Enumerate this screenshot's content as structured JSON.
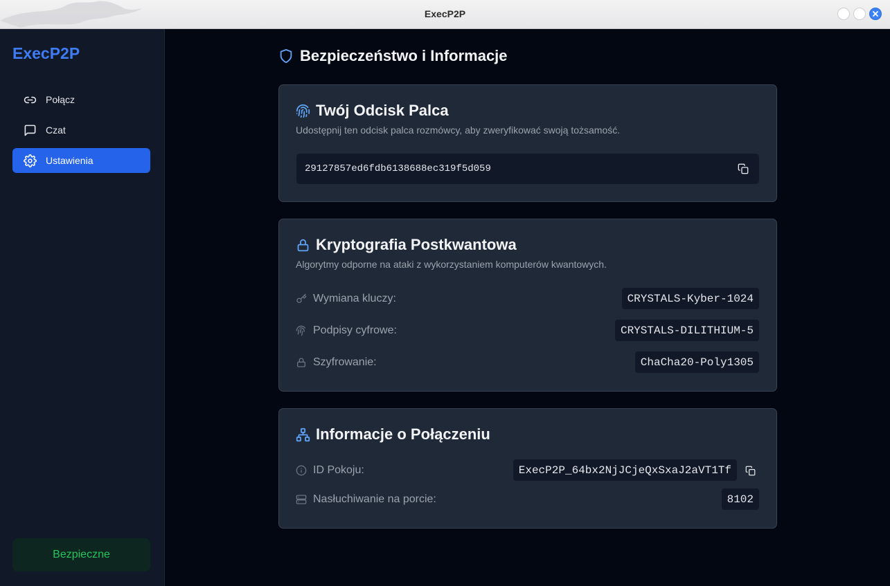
{
  "window": {
    "title": "ExecP2P"
  },
  "sidebar": {
    "brand": "ExecP2P",
    "items": [
      {
        "label": "Połącz",
        "icon": "link-icon",
        "active": false
      },
      {
        "label": "Czat",
        "icon": "chat-icon",
        "active": false
      },
      {
        "label": "Ustawienia",
        "icon": "gear-icon",
        "active": true
      }
    ],
    "status": "Bezpieczne"
  },
  "main": {
    "title": "Bezpieczeństwo i Informacje",
    "fingerprint": {
      "title": "Twój Odcisk Palca",
      "subtitle": "Udostępnij ten odcisk palca rozmówcy, aby zweryfikować swoją tożsamość.",
      "value": "29127857ed6fdb6138688ec319f5d059"
    },
    "pqc": {
      "title": "Kryptografia Postkwantowa",
      "subtitle": "Algorytmy odporne na ataki z wykorzystaniem komputerów kwantowych.",
      "rows": [
        {
          "label": "Wymiana kluczy:",
          "value": "CRYSTALS-Kyber-1024",
          "icon": "key-icon"
        },
        {
          "label": "Podpisy cyfrowe:",
          "value": "CRYSTALS-DILITHIUM-5",
          "icon": "fingerprint-icon"
        },
        {
          "label": "Szyfrowanie:",
          "value": "ChaCha20-Poly1305",
          "icon": "lock-icon"
        }
      ]
    },
    "connection": {
      "title": "Informacje o Połączeniu",
      "rows": [
        {
          "label": "ID Pokoju:",
          "value": "ExecP2P_64bx2NjJCjeQxSxaJ2aVT1Tf",
          "icon": "info-icon"
        },
        {
          "label": "Nasłuchiwanie na porcie:",
          "value": "8102",
          "icon": "server-icon"
        }
      ]
    }
  },
  "colors": {
    "accent": "#2563eb",
    "brand": "#3f7cf4",
    "success": "#22c55e",
    "card": "#1f2937",
    "background": "#030712"
  }
}
